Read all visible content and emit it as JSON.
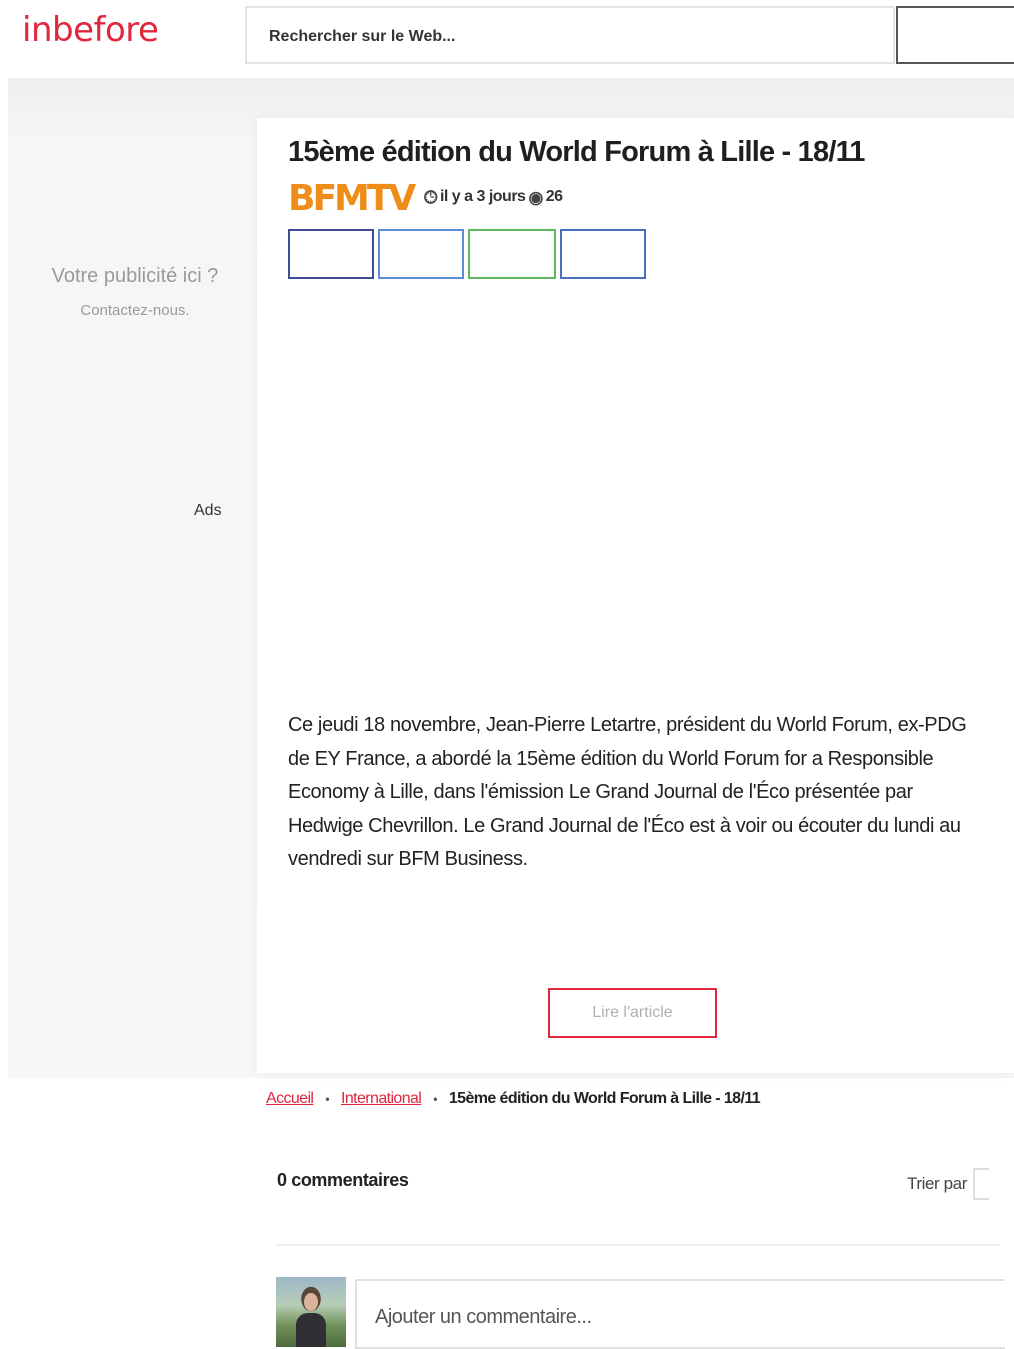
{
  "header": {
    "logo": "inbefore",
    "search_placeholder": "Rechercher sur le Web..."
  },
  "sidebar": {
    "ad_title": "Votre publicité ici ?",
    "ad_contact": "Contactez-nous.",
    "ads_label": "Ads"
  },
  "article": {
    "title": "15ème édition du World Forum à Lille - 18/11",
    "source": "BFMTV",
    "time_ago": "il y a 3 jours",
    "views": "26",
    "summary": "Ce jeudi 18 novembre, Jean-Pierre Letartre, président du World Forum, ex-PDG de EY France, a abordé la 15ème édition du World Forum for a Responsible Economy à Lille, dans l'émission Le Grand Journal de l'Éco présentée par Hedwige Chevrillon. Le Grand Journal de l'Éco est à voir ou écouter du lundi au vendredi sur BFM Business.",
    "read_button": "Lire l'article"
  },
  "breadcrumb": {
    "home": "Accueil",
    "category": "International",
    "current": "15ème édition du World Forum à Lille - 18/11",
    "separator": "•"
  },
  "comments": {
    "count_label": "0 commentaires",
    "sort_label": "Trier par",
    "input_placeholder": "Ajouter un commentaire..."
  },
  "colors": {
    "brand": "#e0273e",
    "source_brand": "#f08c18"
  }
}
